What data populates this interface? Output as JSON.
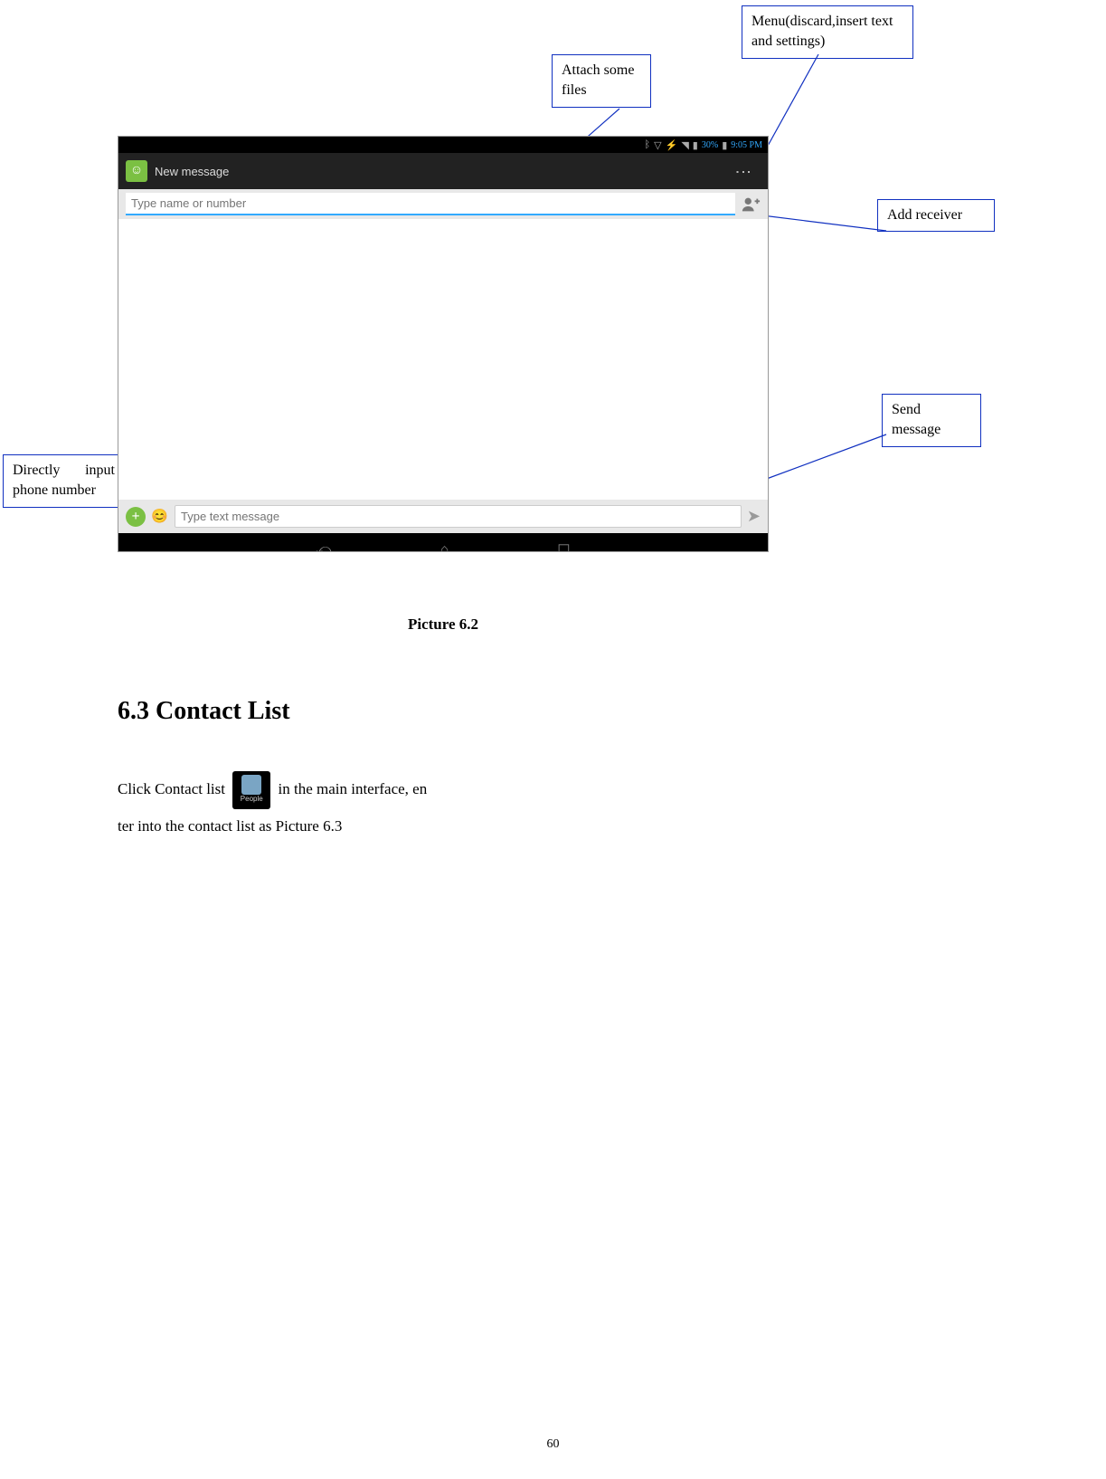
{
  "callouts": {
    "menu": "Menu(discard,insert text and settings)",
    "attach": "Attach some files",
    "add_receiver": "Add receiver",
    "send": "Send message",
    "direct_input": "Directly input phone number"
  },
  "screenshot": {
    "status": {
      "battery_text": "30%",
      "time": "9:05 PM"
    },
    "app_title": "New message",
    "recipient_placeholder": "Type name or number",
    "compose_placeholder": "Type text message"
  },
  "caption": "Picture 6.2",
  "section_heading": "6.3 Contact List",
  "body": {
    "part1": "Click Contact list ",
    "part2": " in the main interface, en",
    "part3": "ter into the contact list as Picture 6.3"
  },
  "people_icon_label": "People",
  "page_number": "60"
}
